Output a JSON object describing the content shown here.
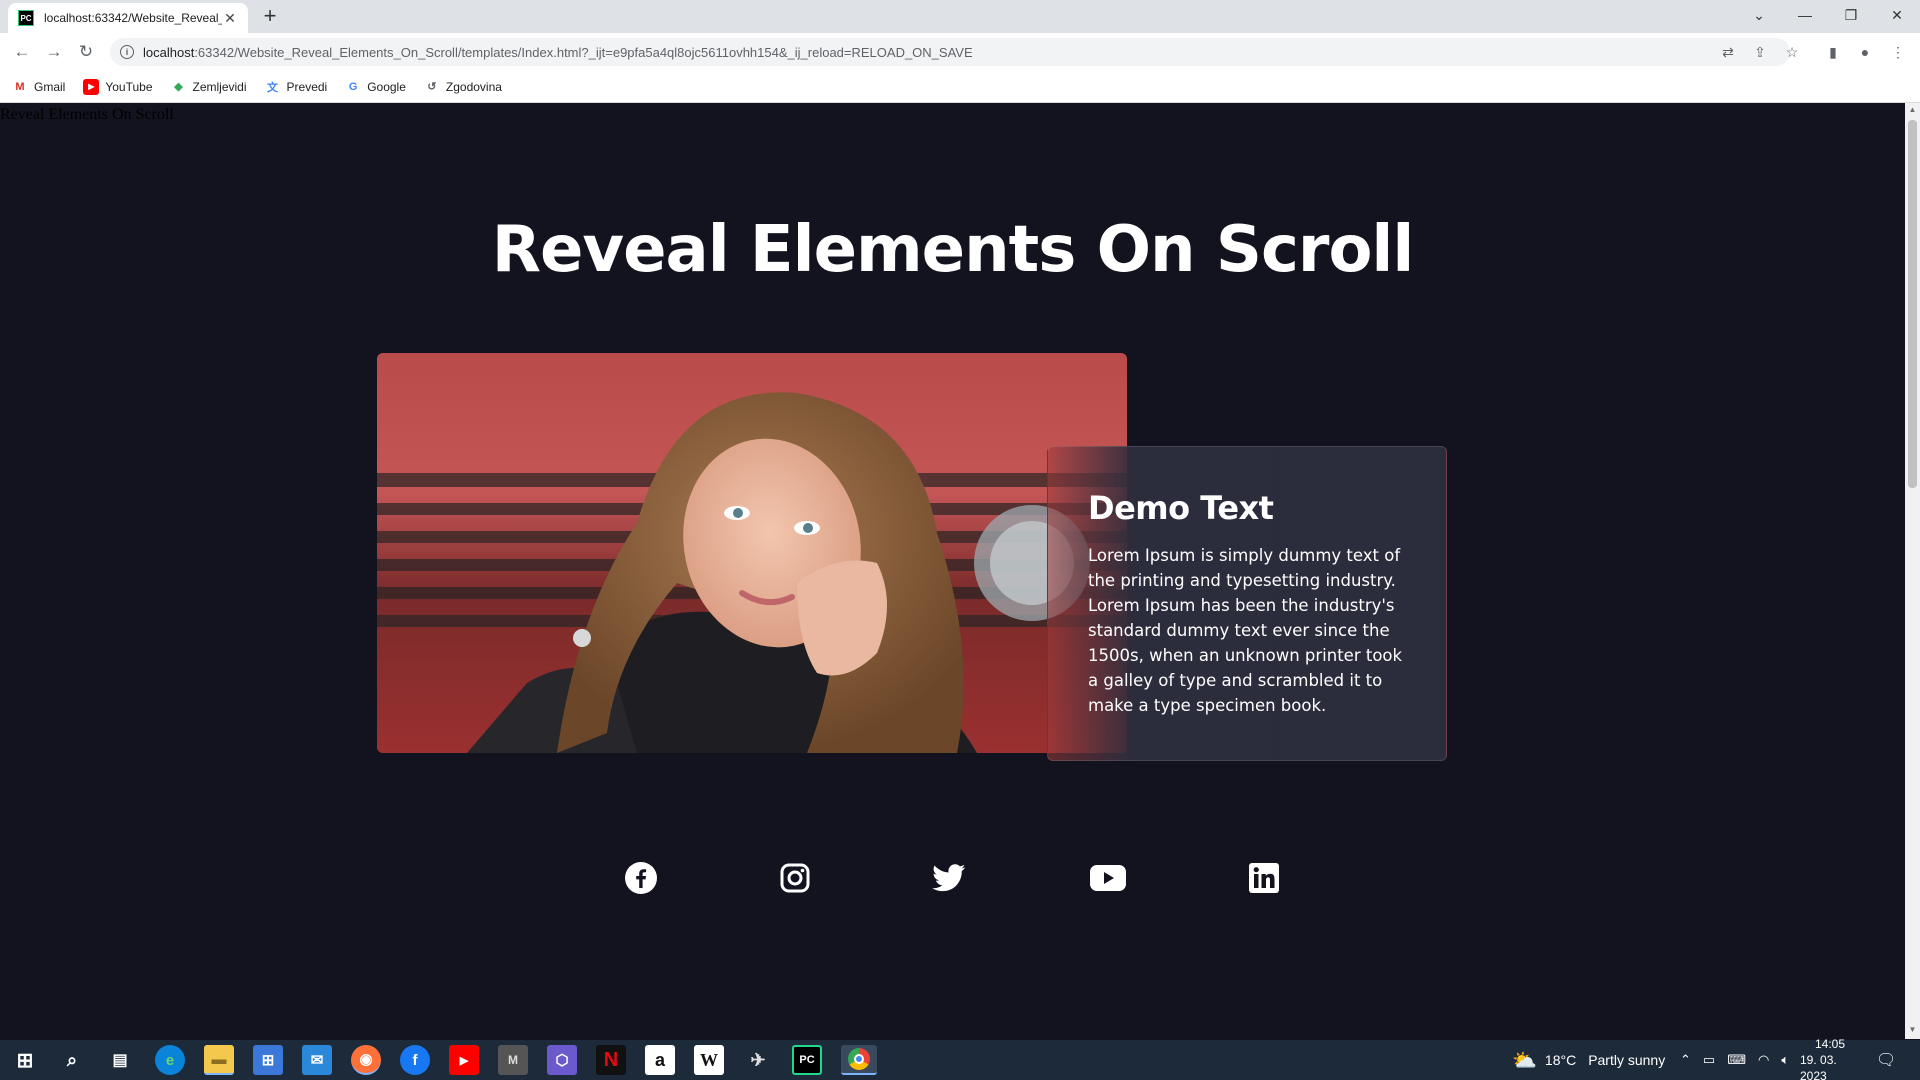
{
  "browser": {
    "tab_title": "localhost:63342/Website_Reveal_",
    "tab_favicon_text": "PC",
    "tab_close": "✕",
    "new_tab": "+",
    "url_host": "localhost",
    "url_rest": ":63342/Website_Reveal_Elements_On_Scroll/templates/Index.html?_ijt=e9pfa5a4ql8ojc5611ovhh154&_ij_reload=RELOAD_ON_SAVE",
    "bookmarks": [
      {
        "label": "Gmail",
        "icon": "gmail-icon",
        "color": "#d93025",
        "glyph": "M"
      },
      {
        "label": "YouTube",
        "icon": "youtube-icon",
        "color": "#ff0000",
        "glyph": "▶"
      },
      {
        "label": "Zemljevidi",
        "icon": "maps-icon",
        "color": "#34a853",
        "glyph": "◆"
      },
      {
        "label": "Prevedi",
        "icon": "translate-icon",
        "color": "#4285f4",
        "glyph": "文"
      },
      {
        "label": "Google",
        "icon": "google-icon",
        "color": "#4285f4",
        "glyph": "G"
      },
      {
        "label": "Zgodovina",
        "icon": "history-icon",
        "color": "#5f6368",
        "glyph": "↺"
      }
    ]
  },
  "page": {
    "doc_title": "Reveal Elements On Scroll",
    "hero_title": "Reveal Elements On Scroll",
    "card_title": "Demo Text",
    "card_text": "Lorem Ipsum is simply dummy text of the printing and typesetting industry. Lorem Ipsum has been the industry's standard dummy text ever since the 1500s, when an unknown printer took a galley of type and scrambled it to make a type specimen book.",
    "photo_subject": "woman-portrait-photo",
    "socials": [
      "facebook-icon",
      "instagram-icon",
      "twitter-icon",
      "youtube-icon",
      "linkedin-icon"
    ]
  },
  "taskbar": {
    "weather_temp": "18°C",
    "weather_text": "Partly sunny",
    "time": "14:05",
    "date": "19. 03. 2023"
  },
  "colors": {
    "page_bg": "#12131f",
    "card_bg": "#2b2c3c",
    "text": "#ffffff",
    "taskbar_bg": "#1c2a3a"
  }
}
